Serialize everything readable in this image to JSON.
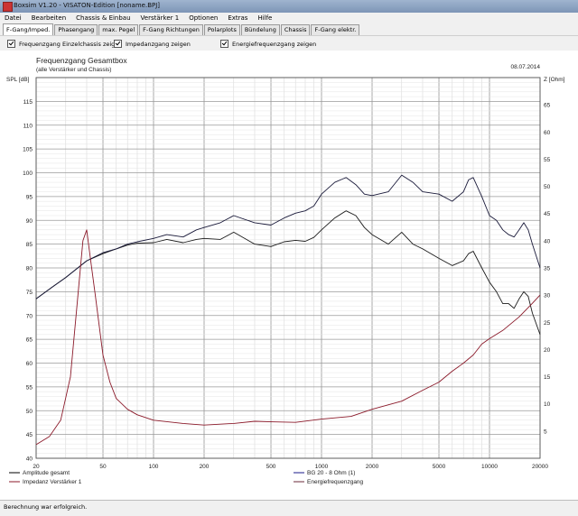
{
  "window": {
    "title": "Boxsim V1.20 - VISATON-Edition [noname.BPJ]"
  },
  "menu": [
    "Datei",
    "Bearbeiten",
    "Chassis & Einbau",
    "Verstärker 1",
    "Optionen",
    "Extras",
    "Hilfe"
  ],
  "tabs": [
    "F-Gang/Imped.",
    "Phasengang",
    "max. Pegel",
    "F-Gang Richtungen",
    "Polarplots",
    "Bündelung",
    "Chassis",
    "F-Gang elektr."
  ],
  "active_tab": 0,
  "options": [
    {
      "label": "Frequenzgang Einzelchassis zeigen",
      "checked": true
    },
    {
      "label": "Impedanzgang zeigen",
      "checked": true
    },
    {
      "label": "Energiefrequenzgang zeigen",
      "checked": true
    }
  ],
  "status": "Berechnung war erfolgreich.",
  "chart_data": {
    "type": "line",
    "title": "Frequenzgang Gesamtbox",
    "subtitle": "(alle Verstärker und Chassis)",
    "date": "08.07.2014",
    "ylabel_left": "SPL [dB]",
    "ylabel_right": "Z [Ohm]",
    "x_scale": "log",
    "xlim": [
      20,
      20000
    ],
    "ylim_left": [
      40,
      120
    ],
    "ylim_right": [
      0,
      70
    ],
    "x_ticks": [
      20,
      50,
      100,
      200,
      500,
      1000,
      2000,
      5000,
      10000,
      20000
    ],
    "y_ticks_left": [
      40,
      45,
      50,
      55,
      60,
      65,
      70,
      75,
      80,
      85,
      90,
      95,
      100,
      105,
      110,
      115
    ],
    "y_ticks_right": [
      5,
      10,
      15,
      20,
      25,
      30,
      35,
      40,
      45,
      50,
      55,
      60,
      65
    ],
    "grid": true,
    "legend_position": "bottom",
    "legend": [
      {
        "name": "Amplitude gesamt",
        "color": "#000000"
      },
      {
        "name": "Impedanz Verstärker 1",
        "color": "#8b1a2a"
      },
      {
        "name": "BG 20 - 8 Ohm       (1)",
        "color": "#1a1a8b"
      },
      {
        "name": "Energiefrequenzgang",
        "color": "#6b2a3a"
      }
    ],
    "series": [
      {
        "name": "Amplitude gesamt",
        "axis": "left",
        "color": "#1a1a1a",
        "x": [
          20,
          25,
          30,
          40,
          50,
          60,
          70,
          80,
          100,
          120,
          150,
          180,
          200,
          250,
          300,
          400,
          500,
          600,
          700,
          800,
          900,
          1000,
          1200,
          1400,
          1600,
          1800,
          2000,
          2500,
          3000,
          3500,
          4000,
          5000,
          6000,
          7000,
          7500,
          8000,
          9000,
          10000,
          11000,
          12000,
          13000,
          14000,
          15000,
          16000,
          17000,
          18000,
          20000
        ],
        "y": [
          73.5,
          76,
          78,
          81.5,
          83,
          84,
          84.8,
          85.2,
          85.3,
          86,
          85.3,
          86,
          86.2,
          86,
          87.5,
          85,
          84.5,
          85.5,
          85.8,
          85.6,
          86.4,
          88,
          90.5,
          92,
          91,
          88.5,
          87,
          85,
          87.5,
          85,
          84,
          82,
          80.5,
          81.5,
          83,
          83.5,
          80,
          77,
          75,
          72.5,
          72.5,
          71.5,
          73.5,
          75,
          74,
          70.5,
          66
        ]
      },
      {
        "name": "BG 20 - 8 Ohm       (1)",
        "axis": "left",
        "color": "#1a1a3a",
        "x": [
          20,
          25,
          30,
          40,
          50,
          60,
          70,
          80,
          100,
          120,
          150,
          180,
          200,
          250,
          300,
          400,
          500,
          600,
          700,
          800,
          900,
          1000,
          1200,
          1400,
          1600,
          1800,
          2000,
          2500,
          3000,
          3500,
          4000,
          5000,
          6000,
          7000,
          7500,
          8000,
          9000,
          10000,
          11000,
          12000,
          13000,
          14000,
          15000,
          16000,
          17000,
          18000,
          20000
        ],
        "y": [
          73.5,
          76,
          78,
          81.5,
          83.2,
          84,
          85,
          85.5,
          86.2,
          87,
          86.5,
          88,
          88.5,
          89.5,
          91,
          89.5,
          89,
          90.5,
          91.5,
          92,
          93,
          95.5,
          98,
          99,
          97.5,
          95.5,
          95.2,
          96,
          99.5,
          98,
          96,
          95.5,
          94,
          96,
          98.5,
          99,
          95,
          91,
          90,
          88,
          87,
          86.5,
          88,
          89.5,
          88,
          85,
          80
        ]
      },
      {
        "name": "Impedanz Verstärker 1",
        "axis": "right",
        "color": "#8b1a2a",
        "x": [
          20,
          24,
          28,
          32,
          35,
          38,
          40,
          42,
          45,
          50,
          55,
          60,
          70,
          80,
          100,
          150,
          200,
          300,
          400,
          500,
          700,
          1000,
          1500,
          2000,
          3000,
          4000,
          5000,
          6000,
          7000,
          8000,
          9000,
          10000,
          12000,
          15000,
          18000,
          20000
        ],
        "y": [
          2.5,
          4,
          7,
          15,
          28,
          40,
          42,
          37,
          30,
          19,
          14,
          11,
          9,
          8,
          7,
          6.4,
          6.1,
          6.4,
          6.8,
          6.7,
          6.6,
          7.2,
          7.7,
          9,
          10.5,
          12.5,
          14,
          16,
          17.5,
          19,
          21,
          22,
          23.5,
          26,
          28.5,
          30
        ]
      }
    ]
  }
}
